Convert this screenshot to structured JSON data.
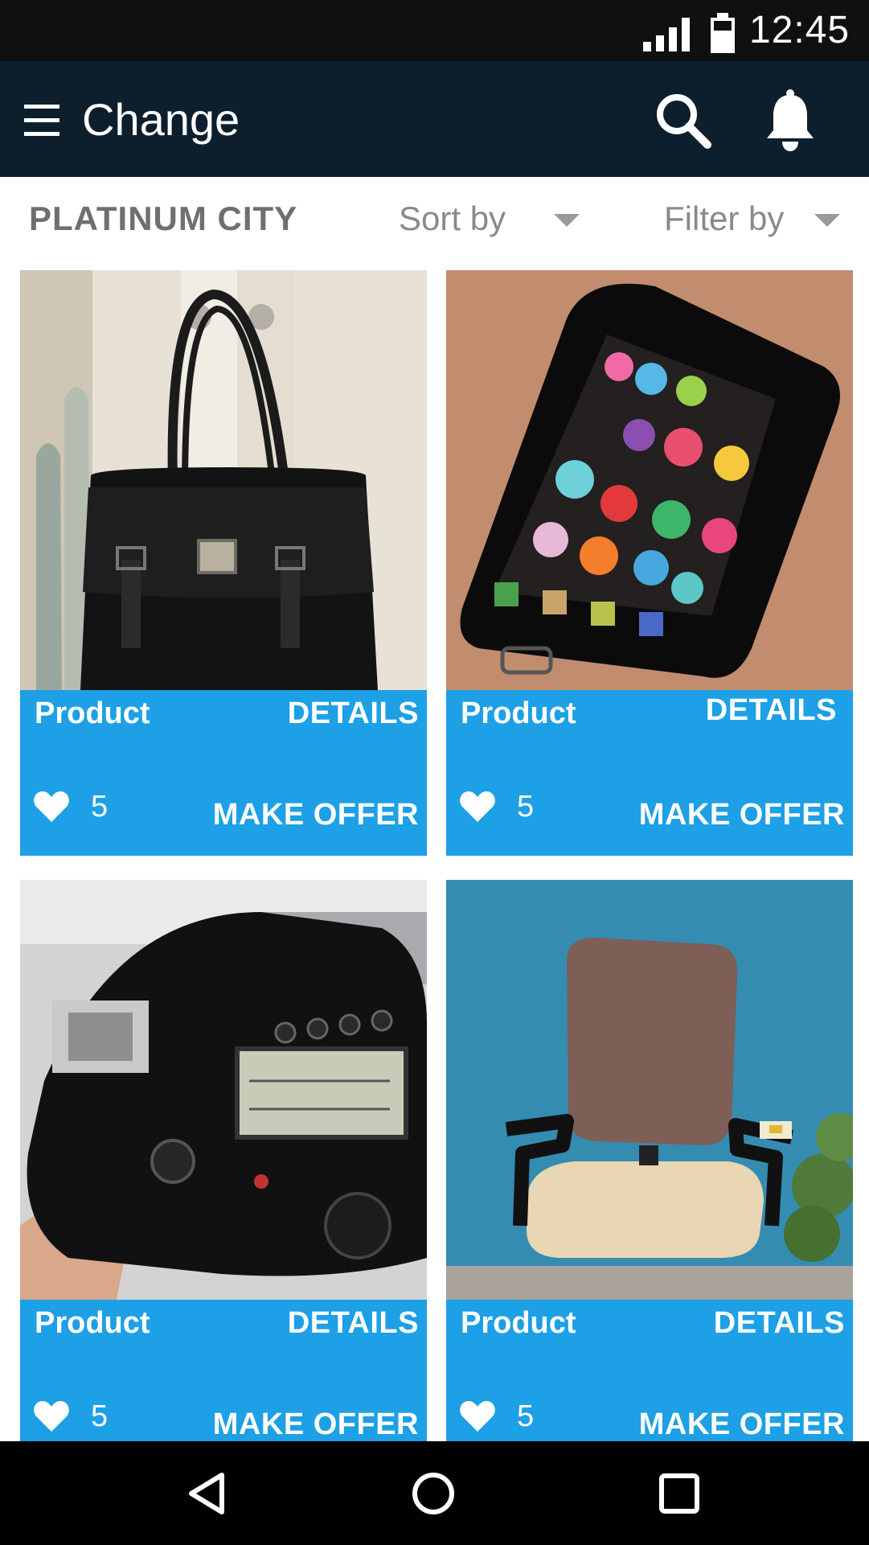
{
  "status_bar": {
    "time": "12:45",
    "icons": [
      "signal-icon",
      "battery-icon"
    ]
  },
  "app_bar": {
    "title": "Change",
    "icons": [
      "menu-icon",
      "search-icon",
      "bell-icon"
    ]
  },
  "filter_bar": {
    "location": "PLATINUM CITY",
    "sort_label": "Sort by",
    "filter_label": "Filter by"
  },
  "products": [
    {
      "name": "Product",
      "details_label": "DETAILS",
      "likes": "5",
      "offer_label": "MAKE OFFER",
      "image": "handbag"
    },
    {
      "name": "Product",
      "details_label": "DETAILS",
      "likes": "5",
      "offer_label": "MAKE OFFER",
      "image": "smartphone"
    },
    {
      "name": "Product",
      "details_label": "DETAILS",
      "likes": "5",
      "offer_label": "MAKE OFFER",
      "image": "camera"
    },
    {
      "name": "Product",
      "details_label": "DETAILS",
      "likes": "5",
      "offer_label": "MAKE OFFER",
      "image": "office-chair"
    }
  ],
  "nav_bar": {
    "icons": [
      "back-icon",
      "home-icon",
      "recents-icon"
    ]
  },
  "colors": {
    "status_bar": "#0f1010",
    "app_bar": "#0d1f2d",
    "card_accent": "#1da0e5",
    "nav_bar": "#000000"
  }
}
